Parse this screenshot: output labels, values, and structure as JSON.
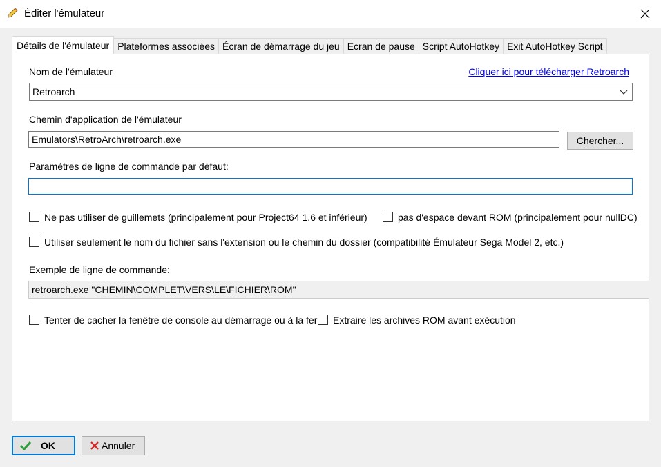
{
  "window": {
    "title": "Éditer l'émulateur",
    "icon": "pencil-icon",
    "close_icon": "close-icon"
  },
  "tabs": [
    {
      "label": "Détails de l'émulateur",
      "active": true
    },
    {
      "label": "Plateformes associées",
      "active": false
    },
    {
      "label": "Écran de démarrage du jeu",
      "active": false
    },
    {
      "label": "Ecran de pause",
      "active": false
    },
    {
      "label": "Script AutoHotkey",
      "active": false
    },
    {
      "label": "Exit AutoHotkey Script",
      "active": false
    }
  ],
  "form": {
    "emulator_name_label": "Nom de l'émulateur",
    "download_link": "Cliquer ici pour télécharger Retroarch",
    "emulator_name_value": "Retroarch",
    "app_path_label": "Chemin d'application de l'émulateur",
    "app_path_value": "Emulators\\RetroArch\\retroarch.exe",
    "browse_button": "Chercher...",
    "cmdline_label": "Paramètres de ligne de commande par défaut:",
    "cmdline_value": "",
    "no_quotes_checkbox": "Ne pas utiliser de guillemets (principalement pour Project64 1.6 et inférieur)",
    "no_space_checkbox": "pas d'espace devant ROM (principalement pour nullDC)",
    "filename_only_checkbox": "Utiliser seulement le nom du fichier sans l'extension ou le chemin du dossier (compatibilité Émulateur Sega Model 2, etc.)",
    "example_label": "Exemple de ligne de commande:",
    "example_value": "retroarch.exe \"CHEMIN\\COMPLET\\VERS\\LE\\FICHIER\\ROM\"",
    "hide_console_checkbox": "Tenter de cacher la fenêtre de console au démarrage ou à la ferm",
    "extract_rom_checkbox": "Extraire les archives ROM avant exécution"
  },
  "footer": {
    "ok_label": "OK",
    "ok_icon": "checkmark-icon",
    "cancel_label": "Annuler",
    "cancel_icon": "x-icon"
  },
  "colors": {
    "accent": "#0078d7",
    "link": "#0000ee",
    "ok_check": "#2e9e3a",
    "cancel_x": "#e02020"
  }
}
